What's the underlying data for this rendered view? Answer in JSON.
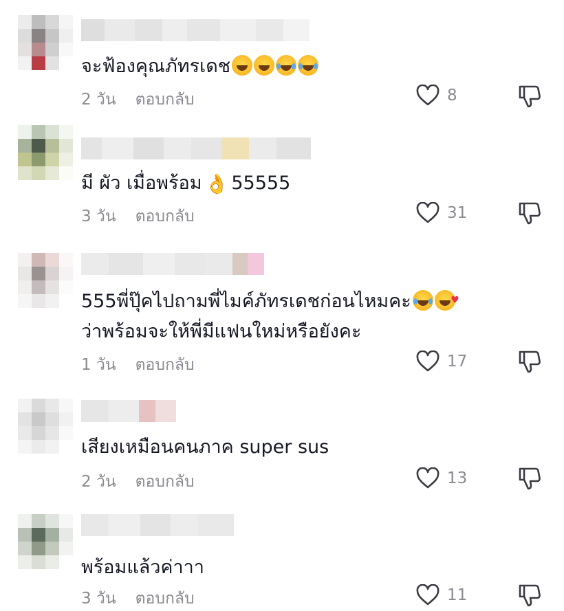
{
  "comments": [
    {
      "text": "จะฟ้องคุณภัทรเดช",
      "emoji": [
        "grin",
        "grin",
        "cry",
        "cry"
      ],
      "time": "2 วัน",
      "reply": "ตอบกลับ",
      "likes": "8"
    },
    {
      "text": "มี ผัว เมื่อพร้อม",
      "emoji_inline": "👌",
      "text_after": "55555",
      "time": "3 วัน",
      "reply": "ตอบกลับ",
      "likes": "31"
    },
    {
      "text_line1": "555พี่ปุ๊คไปถามพี่ไมค์ภัทรเดชก่อนไหมคะ",
      "text_line2": "ว่าพร้อมจะให้พี่มีแฟนใหม่หรือยังคะ",
      "emoji": [
        "cry",
        "love"
      ],
      "time": "1 วัน",
      "reply": "ตอบกลับ",
      "likes": "17"
    },
    {
      "text": "เสียงเหมือนคนภาค super sus",
      "time": "2 วัน",
      "reply": "ตอบกลับ",
      "likes": "13"
    },
    {
      "text": "พร้อมแล้วค่าาา",
      "time": "3 วัน",
      "reply": "ตอบกลับ",
      "likes": "11"
    }
  ],
  "icons": {
    "like": "heart-outline-icon",
    "dislike": "thumbs-down-icon"
  }
}
